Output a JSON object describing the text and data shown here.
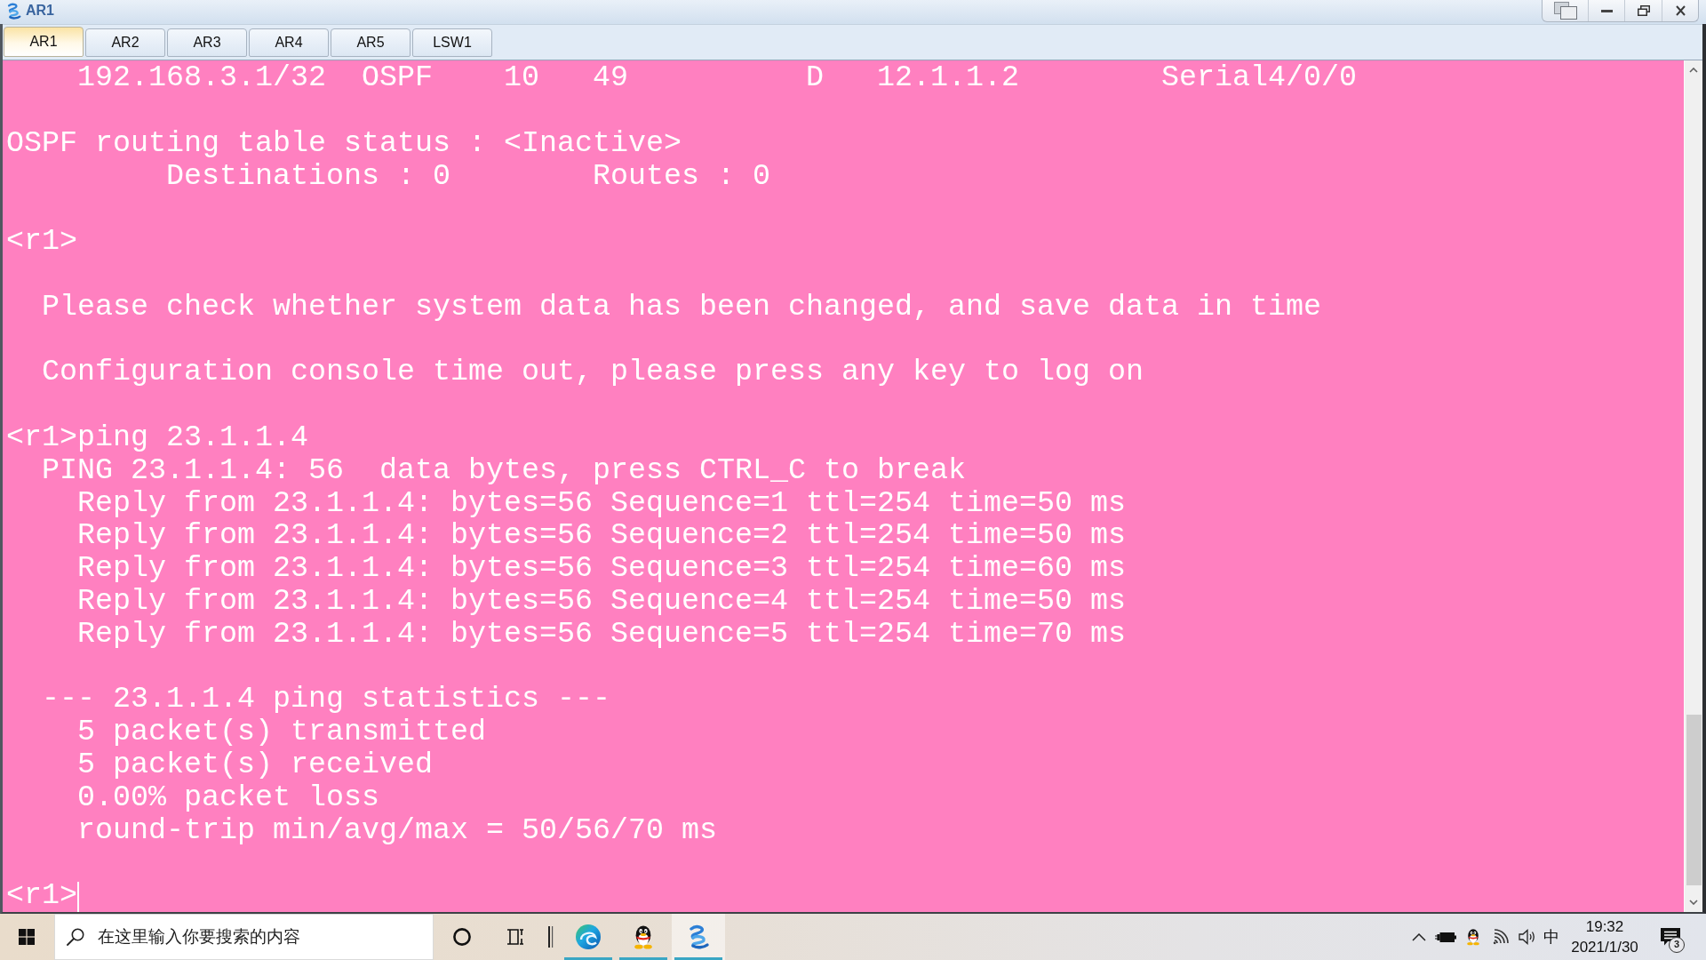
{
  "window": {
    "title": "AR1"
  },
  "tabs": [
    {
      "label": "AR1",
      "selected": true
    },
    {
      "label": "AR2",
      "selected": false
    },
    {
      "label": "AR3",
      "selected": false
    },
    {
      "label": "AR4",
      "selected": false
    },
    {
      "label": "AR5",
      "selected": false
    },
    {
      "label": "LSW1",
      "selected": false
    }
  ],
  "terminal": {
    "blocks": [
      [
        "    192.168.3.1/32  OSPF    10   49          D   12.1.1.2        Serial4/0/0"
      ],
      [
        "OSPF routing table status : <Inactive>",
        "         Destinations : 0        Routes : 0"
      ],
      [
        "<r1>"
      ],
      [
        "  Please check whether system data has been changed, and save data in time"
      ],
      [
        "  Configuration console time out, please press any key to log on"
      ],
      [
        "<r1>ping 23.1.1.4",
        "  PING 23.1.1.4: 56  data bytes, press CTRL_C to break",
        "    Reply from 23.1.1.4: bytes=56 Sequence=1 ttl=254 time=50 ms",
        "    Reply from 23.1.1.4: bytes=56 Sequence=2 ttl=254 time=50 ms",
        "    Reply from 23.1.1.4: bytes=56 Sequence=3 ttl=254 time=60 ms",
        "    Reply from 23.1.1.4: bytes=56 Sequence=4 ttl=254 time=50 ms",
        "    Reply from 23.1.1.4: bytes=56 Sequence=5 ttl=254 time=70 ms"
      ],
      [
        "  --- 23.1.1.4 ping statistics ---",
        "    5 packet(s) transmitted",
        "    5 packet(s) received",
        "    0.00% packet loss",
        "    round-trip min/avg/max = 50/56/70 ms"
      ],
      [
        "<r1>"
      ]
    ],
    "cursor": true
  },
  "taskbar": {
    "search": {
      "placeholder": "在这里输入你要搜索的内容"
    },
    "apps": [
      {
        "kind": "browser",
        "running": true,
        "active": false
      },
      {
        "kind": "messenger",
        "running": true,
        "active": false
      },
      {
        "kind": "simulator",
        "running": true,
        "active": true
      }
    ],
    "input_method": "中",
    "clock": {
      "time": "19:32",
      "date": "2021/1/30"
    },
    "notifications": {
      "count": "3"
    }
  }
}
